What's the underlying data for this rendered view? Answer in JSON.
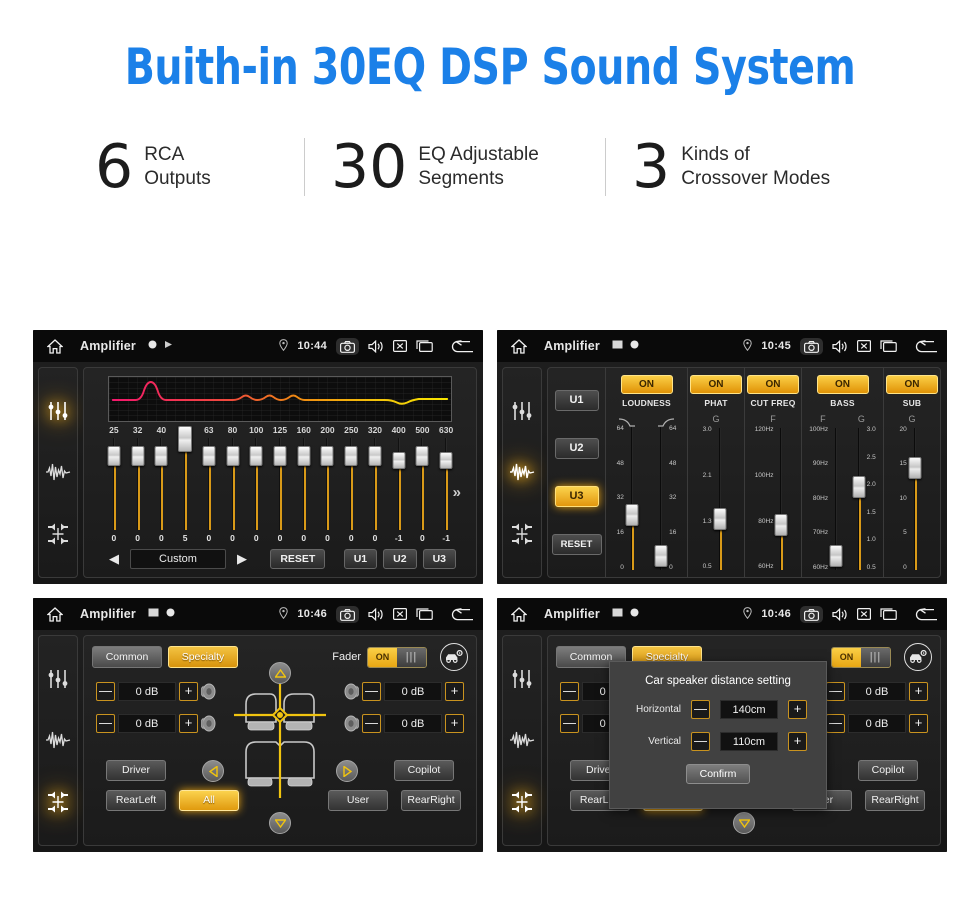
{
  "hero": {
    "title": "Buith-in 30EQ DSP Sound System",
    "accent_color": "#1b80e8"
  },
  "stats": [
    {
      "number": "6",
      "line1": "RCA",
      "line2": "Outputs"
    },
    {
      "number": "30",
      "line1": "EQ Adjustable",
      "line2": "Segments"
    },
    {
      "number": "3",
      "line1": "Kinds of",
      "line2": "Crossover Modes"
    }
  ],
  "panels": {
    "eq": {
      "statusbar": {
        "title": "Amplifier",
        "time": "10:44",
        "icons": [
          "home-icon",
          "record-icon",
          "play-icon",
          "location-pin-icon",
          "camera-icon",
          "speaker-icon",
          "close-box-icon",
          "recents-icon",
          "back-icon"
        ]
      },
      "sidebar": [
        "equalizer-icon",
        "waveform-icon",
        "balance-icon"
      ],
      "frequencies": [
        "25",
        "32",
        "40",
        "50",
        "63",
        "80",
        "100",
        "125",
        "160",
        "200",
        "250",
        "320",
        "400",
        "500",
        "630"
      ],
      "values": [
        0,
        0,
        0,
        5,
        0,
        0,
        0,
        0,
        0,
        0,
        0,
        0,
        -1,
        0,
        -1
      ],
      "expand_label": "»",
      "prev_label": "◀",
      "next_label": "▶",
      "preset_name": "Custom",
      "reset_label": "RESET",
      "user_presets": [
        "U1",
        "U2",
        "U3"
      ]
    },
    "crossover": {
      "statusbar": {
        "title": "Amplifier",
        "time": "10:45"
      },
      "presets": [
        {
          "label": "U1",
          "active": false
        },
        {
          "label": "U2",
          "active": false
        },
        {
          "label": "U3",
          "active": true
        },
        {
          "label": "RESET",
          "active": false
        }
      ],
      "sections": [
        {
          "name": "LOUDNESS",
          "on_label": "ON",
          "heads": [
            "curve-down-icon",
            "curve-up-icon"
          ],
          "rails": [
            {
              "ticks": [
                "64",
                "48",
                "32",
                "16",
                "0"
              ],
              "value_pct": 36
            },
            {
              "ticks": [
                "64",
                "48",
                "32",
                "16",
                "0"
              ],
              "value_pct": 5
            }
          ]
        },
        {
          "name": "PHAT",
          "on_label": "ON",
          "heads": [
            "G"
          ],
          "rails": [
            {
              "ticks": [
                "3.0",
                "2.1",
                "1.3",
                "0.5"
              ],
              "value_pct": 33
            }
          ]
        },
        {
          "name": "CUT FREQ",
          "on_label": "ON",
          "heads": [
            "F"
          ],
          "rails": [
            {
              "ticks": [
                "120Hz",
                "100Hz",
                "80Hz",
                "60Hz"
              ],
              "value_pct": 29
            }
          ]
        },
        {
          "name": "BASS",
          "on_label": "ON",
          "heads": [
            "F",
            "G"
          ],
          "rails": [
            {
              "ticks": [
                "100Hz",
                "90Hz",
                "80Hz",
                "70Hz",
                "60Hz"
              ],
              "value_pct": 5
            },
            {
              "ticks": [
                "3.0",
                "2.5",
                "2.0",
                "1.5",
                "1.0",
                "0.5"
              ],
              "value_pct": 56
            }
          ]
        },
        {
          "name": "SUB",
          "on_label": "ON",
          "heads": [
            "G"
          ],
          "rails": [
            {
              "ticks": [
                "20",
                "15",
                "10",
                "5",
                "0"
              ],
              "value_pct": 69
            }
          ]
        }
      ]
    },
    "fader": {
      "statusbar": {
        "title": "Amplifier",
        "time": "10:46"
      },
      "tabs": [
        {
          "label": "Common",
          "active": false
        },
        {
          "label": "Specialty",
          "active": true
        }
      ],
      "fader_label": "Fader",
      "toggle": {
        "on_label": "ON",
        "off_label": "|||"
      },
      "car_setting_icon": "car-settings-icon",
      "steppers": [
        {
          "minus": "—",
          "value": "0 dB",
          "plus": "+"
        },
        {
          "minus": "—",
          "value": "0 dB",
          "plus": "+"
        },
        {
          "minus": "—",
          "value": "0 dB",
          "plus": "+"
        },
        {
          "minus": "—",
          "value": "0 dB",
          "plus": "+"
        }
      ],
      "seat_buttons": [
        {
          "label": "Driver",
          "active": false
        },
        {
          "label": "Copilot",
          "active": false
        },
        {
          "label": "RearLeft",
          "active": false
        },
        {
          "label": "All",
          "active": true
        },
        {
          "label": "User",
          "active": false
        },
        {
          "label": "RearRight",
          "active": false
        }
      ]
    },
    "dialog": {
      "statusbar": {
        "title": "Amplifier",
        "time": "10:46"
      },
      "modal": {
        "title": "Car speaker distance setting",
        "rows": [
          {
            "label": "Horizontal",
            "minus": "—",
            "value": "140cm",
            "plus": "+"
          },
          {
            "label": "Vertical",
            "minus": "—",
            "value": "110cm",
            "plus": "+"
          }
        ],
        "confirm_label": "Confirm"
      }
    }
  },
  "colors": {
    "amber": "#e9a311",
    "amber_light": "#fbd34d",
    "panel_bg": "#1a1a1a",
    "statusbar_bg": "#0a0a0a"
  }
}
